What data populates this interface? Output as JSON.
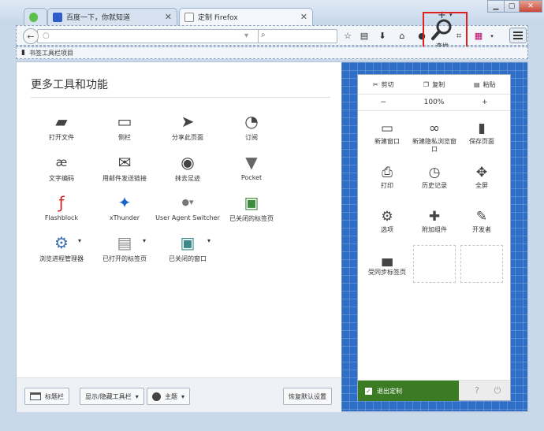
{
  "tabs": [
    {
      "title": ""
    },
    {
      "title": "百度一下，你就知道"
    },
    {
      "title": "定制 Firefox"
    }
  ],
  "toolbar": {
    "find_label": "查找"
  },
  "bookmarks": {
    "item_label": "书签工具栏项目"
  },
  "palette": {
    "title": "更多工具和功能",
    "tools": [
      {
        "label": "打开文件",
        "icon": "folder-icon"
      },
      {
        "label": "侧栏",
        "icon": "sidebar-icon"
      },
      {
        "label": "分享此页面",
        "icon": "share-icon"
      },
      {
        "label": "订阅",
        "icon": "rss-icon"
      },
      {
        "label": "文字编码",
        "icon": "character-encoding-icon"
      },
      {
        "label": "用邮件发送链接",
        "icon": "email-icon"
      },
      {
        "label": "抹去足迹",
        "icon": "forget-icon"
      },
      {
        "label": "Pocket",
        "icon": "pocket-icon"
      },
      {
        "label": "Flashblock",
        "icon": "flashblock-icon"
      },
      {
        "label": "xThunder",
        "icon": "xthunder-icon"
      },
      {
        "label": "User Agent Switcher",
        "icon": "user-agent-icon"
      },
      {
        "label": "已关闭的标签页",
        "icon": "closed-tabs-icon"
      },
      {
        "label": "浏览进程管理器",
        "icon": "process-manager-icon"
      },
      {
        "label": "已打开的标签页",
        "icon": "open-tabs-icon"
      },
      {
        "label": "已关闭的窗口",
        "icon": "closed-windows-icon"
      }
    ]
  },
  "bottom": {
    "titlebar_btn": "标题栏",
    "toolbars_btn": "显示/隐藏工具栏",
    "themes_btn": "主题",
    "restore_btn": "恢复默认设置"
  },
  "panel": {
    "cut": "剪切",
    "copy": "复制",
    "paste": "粘贴",
    "zoom_out": "−",
    "zoom_level": "100%",
    "zoom_in": "+",
    "items": [
      {
        "label": "新建窗口",
        "icon": "new-window-icon"
      },
      {
        "label": "新建隐私浏览窗口",
        "icon": "private-window-icon"
      },
      {
        "label": "保存页面",
        "icon": "save-page-icon"
      },
      {
        "label": "打印",
        "icon": "print-icon"
      },
      {
        "label": "历史记录",
        "icon": "history-icon"
      },
      {
        "label": "全屏",
        "icon": "fullscreen-icon"
      },
      {
        "label": "选项",
        "icon": "options-icon"
      },
      {
        "label": "附加组件",
        "icon": "addons-icon"
      },
      {
        "label": "开发者",
        "icon": "developer-icon"
      },
      {
        "label": "受同步标签页",
        "icon": "synced-tabs-icon"
      }
    ],
    "exit_label": "退出定制"
  }
}
